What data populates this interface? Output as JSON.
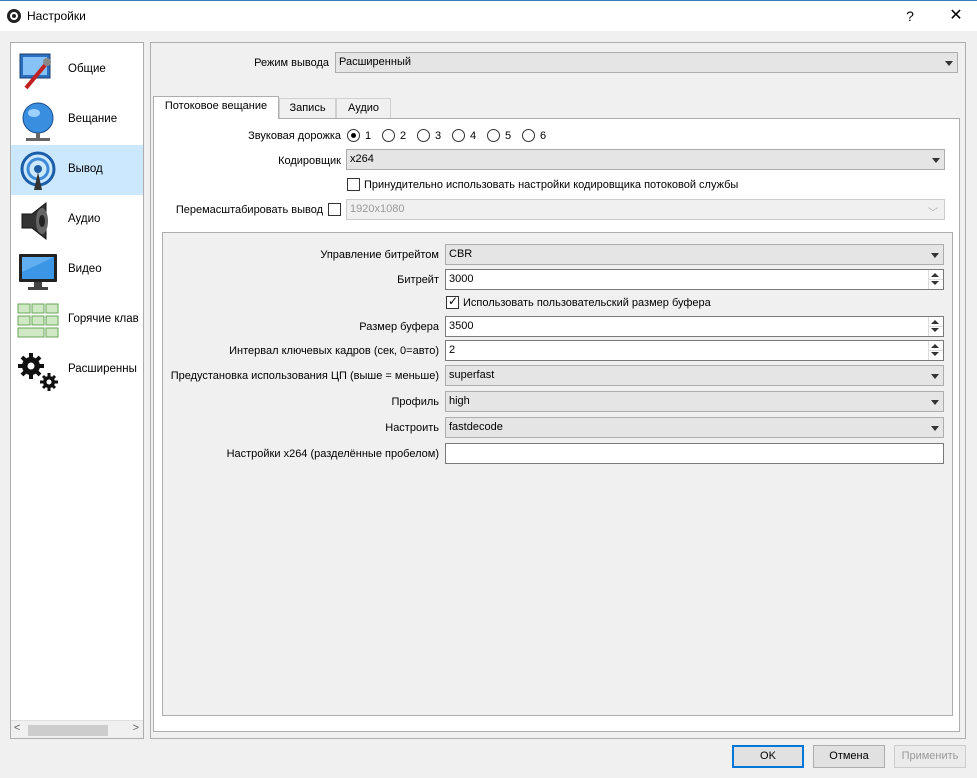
{
  "window": {
    "title": "Настройки",
    "help": "?",
    "close": "✕"
  },
  "sidebar": {
    "items": [
      {
        "label": "Общие",
        "icon": "general-icon"
      },
      {
        "label": "Вещание",
        "icon": "broadcast-globe-icon"
      },
      {
        "label": "Вывод",
        "icon": "output-signal-icon",
        "active": true
      },
      {
        "label": "Аудио",
        "icon": "speaker-icon"
      },
      {
        "label": "Видео",
        "icon": "monitor-icon"
      },
      {
        "label": "Горячие клав",
        "icon": "keyboard-hotkeys-icon"
      },
      {
        "label": "Расширенны",
        "icon": "gears-icon"
      }
    ],
    "scroll_left": "<",
    "scroll_right": ">"
  },
  "output": {
    "mode_label": "Режим вывода",
    "mode_value": "Расширенный"
  },
  "tabs": [
    {
      "label": "Потоковое вещание",
      "active": true
    },
    {
      "label": "Запись"
    },
    {
      "label": "Аудио"
    }
  ],
  "streaming": {
    "audio_track_label": "Звуковая дорожка",
    "audio_tracks": [
      "1",
      "2",
      "3",
      "4",
      "5",
      "6"
    ],
    "audio_track_selected": "1",
    "encoder_label": "Кодировщик",
    "encoder_value": "x264",
    "enforce_label": "Принудительно использовать настройки кодировщика потоковой службы",
    "enforce_checked": false,
    "rescale_label": "Перемасштабировать вывод",
    "rescale_checked": false,
    "rescale_value": "1920x1080"
  },
  "encoder": {
    "rate_control_label": "Управление битрейтом",
    "rate_control_value": "CBR",
    "bitrate_label": "Битрейт",
    "bitrate_value": "3000",
    "custom_buffer_label": "Использовать пользовательский размер буфера",
    "custom_buffer_checked": true,
    "buffer_size_label": "Размер буфера",
    "buffer_size_value": "3500",
    "keyframe_label": "Интервал ключевых кадров (сек, 0=авто)",
    "keyframe_value": "2",
    "cpu_preset_label": "Предустановка использования ЦП (выше = меньше)",
    "cpu_preset_value": "superfast",
    "profile_label": "Профиль",
    "profile_value": "high",
    "tune_label": "Настроить",
    "tune_value": "fastdecode",
    "x264_opts_label": "Настройки x264 (разделённые пробелом)",
    "x264_opts_value": ""
  },
  "buttons": {
    "ok": "OK",
    "cancel": "Отмена",
    "apply": "Применить"
  }
}
